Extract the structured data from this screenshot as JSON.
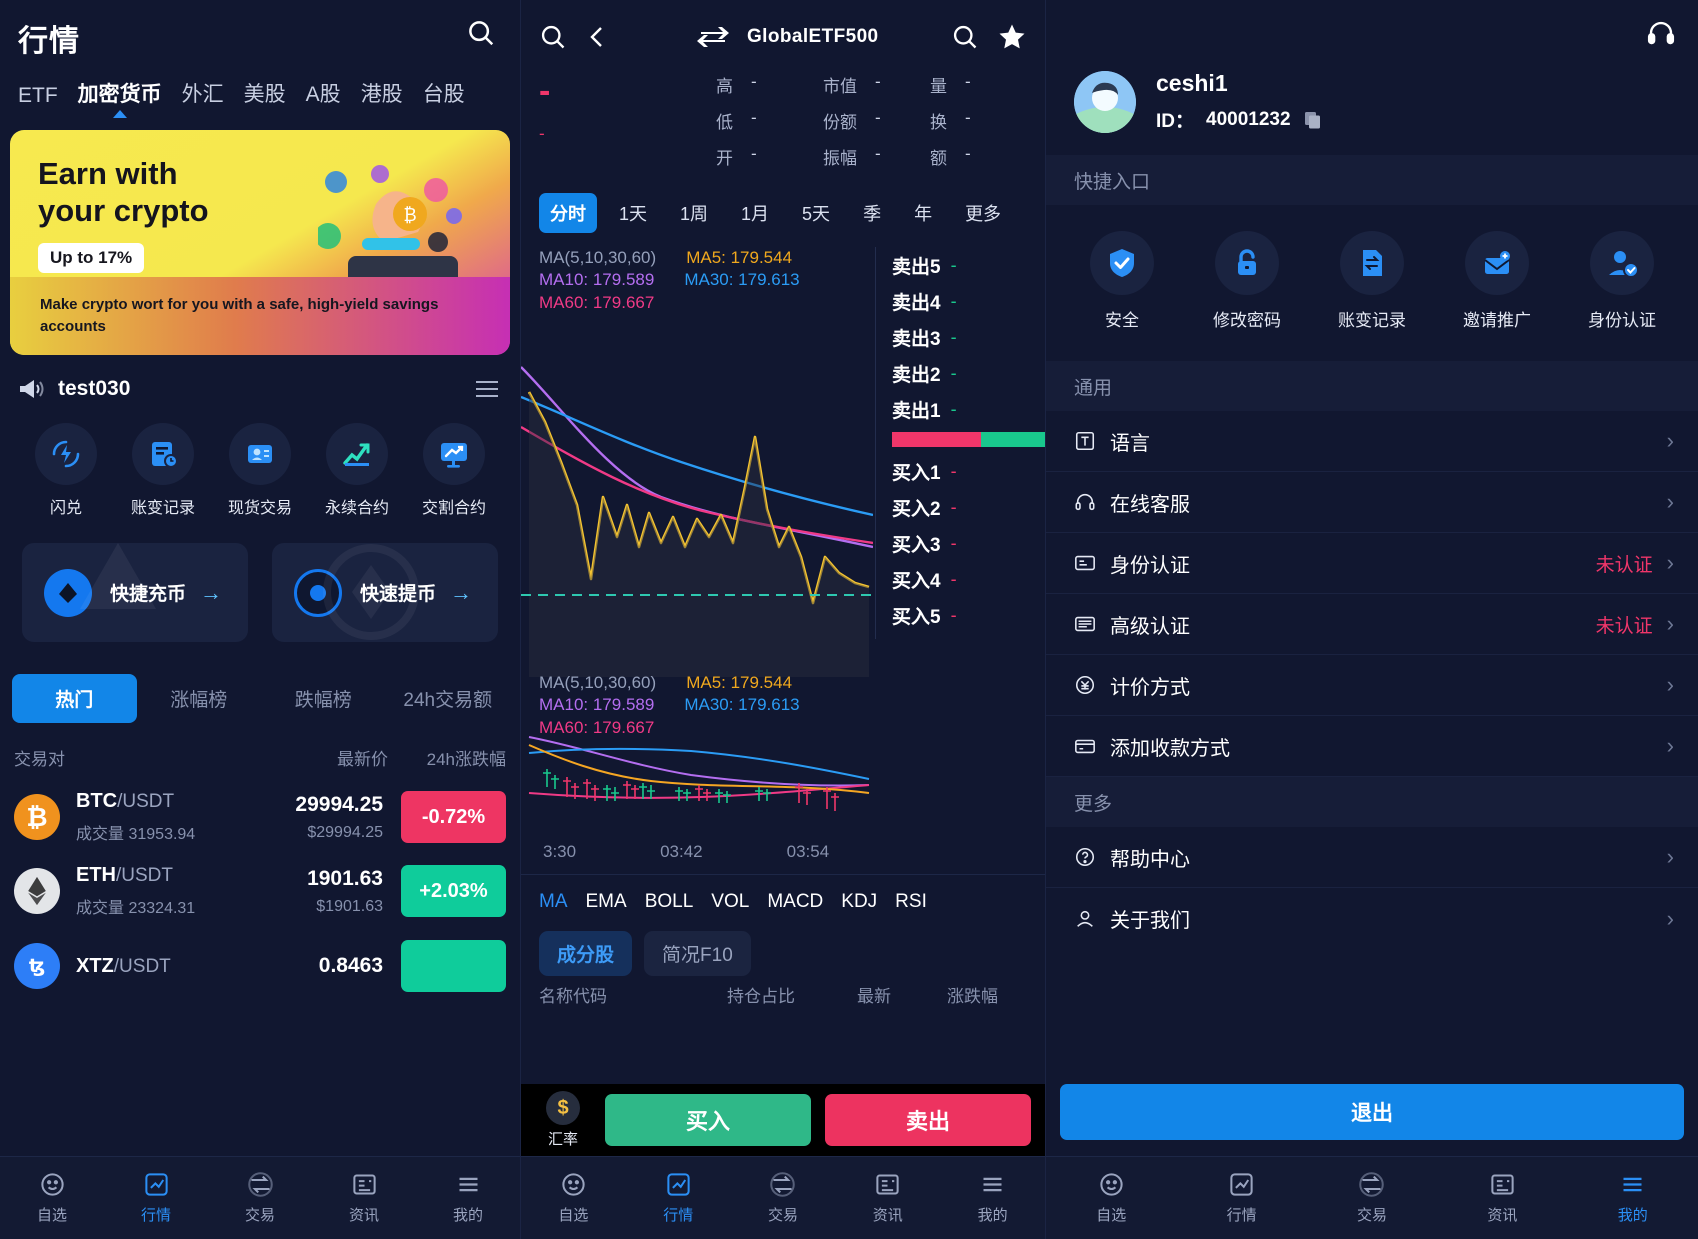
{
  "left": {
    "title": "行情",
    "search_icon": "search-icon",
    "tabs": [
      {
        "label": "ETF",
        "active": false
      },
      {
        "label": "加密货币",
        "active": true
      },
      {
        "label": "外汇",
        "active": false
      },
      {
        "label": "美股",
        "active": false
      },
      {
        "label": "A股",
        "active": false
      },
      {
        "label": "港股",
        "active": false
      },
      {
        "label": "台股",
        "active": false
      }
    ],
    "banner": {
      "line1": "Earn with",
      "line2": "your crypto",
      "pill": "Up to 17%",
      "footer": "Make crypto wort for you with a safe, high-yield savings accounts"
    },
    "notice": {
      "icon": "megaphone-icon",
      "text": "test030",
      "list_icon": "list-icon"
    },
    "quick_entries": [
      {
        "label": "闪兑",
        "icon": "flash-swap-icon"
      },
      {
        "label": "账变记录",
        "icon": "account-record-icon"
      },
      {
        "label": "现货交易",
        "icon": "spot-trade-icon"
      },
      {
        "label": "永续合约",
        "icon": "perpetual-icon"
      },
      {
        "label": "交割合约",
        "icon": "delivery-icon"
      }
    ],
    "cards": [
      {
        "label": "快捷充币",
        "icon": "deposit-coin-icon"
      },
      {
        "label": "快速提币",
        "icon": "withdraw-coin-icon"
      }
    ],
    "rank_tabs": [
      {
        "label": "热门",
        "active": true
      },
      {
        "label": "涨幅榜",
        "active": false
      },
      {
        "label": "跌幅榜",
        "active": false
      },
      {
        "label": "24h交易额",
        "active": false
      }
    ],
    "table_headers": {
      "pair": "交易对",
      "price": "最新价",
      "change": "24h涨跌幅"
    },
    "rows": [
      {
        "base": "BTC",
        "quote": "/USDT",
        "vol_label": "成交量",
        "vol": "31953.94",
        "price": "29994.25",
        "usd": "$29994.25",
        "change": "-0.72%",
        "dir": "down",
        "icon": "btc-icon"
      },
      {
        "base": "ETH",
        "quote": "/USDT",
        "vol_label": "成交量",
        "vol": "23324.31",
        "price": "1901.63",
        "usd": "$1901.63",
        "change": "+2.03%",
        "dir": "up",
        "icon": "eth-icon"
      },
      {
        "base": "XTZ",
        "quote": "/USDT",
        "vol_label": "成交量",
        "vol": "",
        "price": "0.8463",
        "usd": "",
        "change": "",
        "dir": "up",
        "icon": "xtz-icon"
      }
    ],
    "bottom_nav": [
      {
        "label": "自选",
        "icon": "star-face-icon",
        "active": false
      },
      {
        "label": "行情",
        "icon": "market-icon",
        "active": true
      },
      {
        "label": "交易",
        "icon": "trade-icon",
        "active": false
      },
      {
        "label": "资讯",
        "icon": "news-icon",
        "active": false
      },
      {
        "label": "我的",
        "icon": "menu-icon",
        "active": false
      }
    ]
  },
  "mid": {
    "search_icon": "search-icon",
    "back_icon": "back-chevron-icon",
    "swap_icon": "swap-arrows-icon",
    "symbol": "GlobalETF500",
    "search_icon2": "search-icon",
    "star_icon": "star-icon",
    "price": "-",
    "price_sub": "-",
    "stats": [
      {
        "k": "高",
        "v": "-"
      },
      {
        "k": "市值",
        "v": "-"
      },
      {
        "k": "量",
        "v": "-"
      },
      {
        "k": "低",
        "v": "-"
      },
      {
        "k": "份额",
        "v": "-"
      },
      {
        "k": "换",
        "v": "-"
      },
      {
        "k": "开",
        "v": "-"
      },
      {
        "k": "振幅",
        "v": "-"
      },
      {
        "k": "额",
        "v": "-"
      }
    ],
    "periods": [
      {
        "label": "分时",
        "active": true
      },
      {
        "label": "1天",
        "active": false
      },
      {
        "label": "1周",
        "active": false
      },
      {
        "label": "1月",
        "active": false
      },
      {
        "label": "5天",
        "active": false
      },
      {
        "label": "季",
        "active": false
      },
      {
        "label": "年",
        "active": false
      },
      {
        "label": "更多",
        "active": false
      }
    ],
    "ma_legend": {
      "title": "MA(5,10,30,60)",
      "ma5": "MA5: 179.544",
      "ma10": "MA10: 179.589",
      "ma30": "MA30: 179.613",
      "ma60": "MA60: 179.667"
    },
    "depth": {
      "sells": [
        {
          "label": "卖出5",
          "value": "-"
        },
        {
          "label": "卖出4",
          "value": "-"
        },
        {
          "label": "卖出3",
          "value": "-"
        },
        {
          "label": "卖出2",
          "value": "-"
        },
        {
          "label": "卖出1",
          "value": "-"
        }
      ],
      "buys": [
        {
          "label": "买入1",
          "value": "-"
        },
        {
          "label": "买入2",
          "value": "-"
        },
        {
          "label": "买入3",
          "value": "-"
        },
        {
          "label": "买入4",
          "value": "-"
        },
        {
          "label": "买入5",
          "value": "-"
        }
      ]
    },
    "xaxis": [
      "3:30",
      "03:42",
      "03:54"
    ],
    "indicators": [
      {
        "label": "MA",
        "active": true
      },
      {
        "label": "EMA",
        "active": false
      },
      {
        "label": "BOLL",
        "active": false
      },
      {
        "label": "VOL",
        "active": false
      },
      {
        "label": "MACD",
        "active": false
      },
      {
        "label": "KDJ",
        "active": false
      },
      {
        "label": "RSI",
        "active": false
      }
    ],
    "sub_tabs": [
      {
        "label": "成分股",
        "active": true
      },
      {
        "label": "简况F10",
        "active": false
      }
    ],
    "sub_headers": [
      "名称代码",
      "持仓占比",
      "最新",
      "涨跌幅"
    ],
    "tradebar": {
      "rate_label": "汇率",
      "rate_icon": "dollar-icon",
      "buy": "买入",
      "sell": "卖出"
    },
    "bottom_nav": [
      {
        "label": "自选",
        "icon": "star-face-icon",
        "active": false
      },
      {
        "label": "行情",
        "icon": "market-icon",
        "active": true
      },
      {
        "label": "交易",
        "icon": "trade-icon",
        "active": false
      },
      {
        "label": "资讯",
        "icon": "news-icon",
        "active": false
      },
      {
        "label": "我的",
        "icon": "menu-icon",
        "active": false
      }
    ]
  },
  "right": {
    "headset_icon": "headset-icon",
    "user": {
      "name": "ceshi1",
      "id_label": "ID：",
      "id": "40001232",
      "copy_icon": "copy-icon",
      "avatar": "avatar"
    },
    "section_quick": "快捷入口",
    "quick_entries": [
      {
        "label": "安全",
        "icon": "shield-check-icon"
      },
      {
        "label": "修改密码",
        "icon": "lock-icon"
      },
      {
        "label": "账变记录",
        "icon": "account-record-icon"
      },
      {
        "label": "邀请推广",
        "icon": "invite-mail-icon"
      },
      {
        "label": "身份认证",
        "icon": "id-verify-icon"
      }
    ],
    "section_general": "通用",
    "general_rows": [
      {
        "label": "语言",
        "icon": "language-icon",
        "value": ""
      },
      {
        "label": "在线客服",
        "icon": "headset-icon",
        "value": ""
      },
      {
        "label": "身份认证",
        "icon": "id-card-icon",
        "value": "未认证"
      },
      {
        "label": "高级认证",
        "icon": "advanced-id-icon",
        "value": "未认证"
      },
      {
        "label": "计价方式",
        "icon": "currency-icon",
        "value": ""
      },
      {
        "label": "添加收款方式",
        "icon": "payment-icon",
        "value": ""
      }
    ],
    "section_more": "更多",
    "more_rows": [
      {
        "label": "帮助中心",
        "icon": "help-icon",
        "value": ""
      },
      {
        "label": "关于我们",
        "icon": "about-icon",
        "value": ""
      }
    ],
    "logout": "退出",
    "bottom_nav": [
      {
        "label": "自选",
        "icon": "star-face-icon",
        "active": false
      },
      {
        "label": "行情",
        "icon": "market-icon",
        "active": false
      },
      {
        "label": "交易",
        "icon": "trade-icon",
        "active": false
      },
      {
        "label": "资讯",
        "icon": "news-icon",
        "active": false
      },
      {
        "label": "我的",
        "icon": "menu-icon",
        "active": true
      }
    ]
  },
  "colors": {
    "accent": "#1286e8",
    "up": "#19c88d",
    "down": "#f0366a",
    "bg": "#111730"
  }
}
